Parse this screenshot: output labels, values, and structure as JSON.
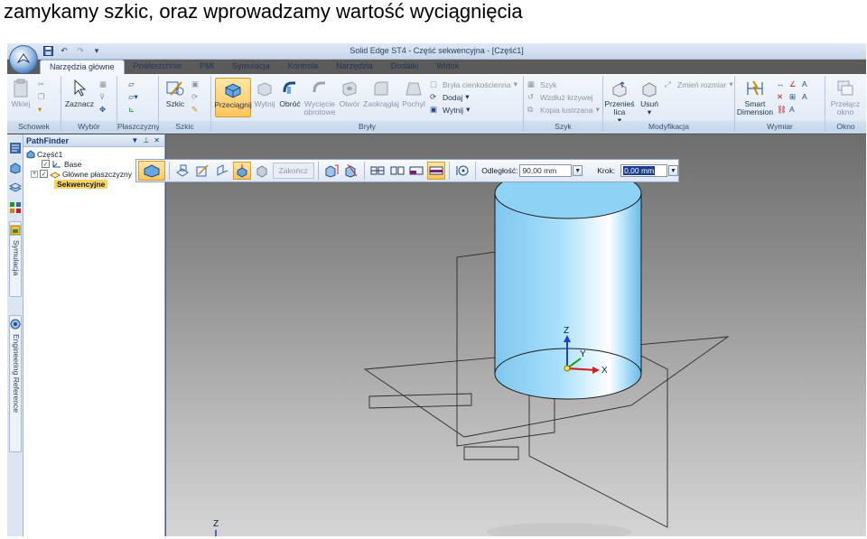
{
  "caption": "zamykamy szkic, oraz wprowadzamy wartość wyciągnięcia",
  "window": {
    "title": "Solid Edge ST4 - Część sekwencyjna - [Część1]"
  },
  "tabs": [
    "Narzędzia główne",
    "Powierzchnie",
    "PMI",
    "Symulacja",
    "Kontrola",
    "Narzędzia",
    "Dodatki",
    "Widok"
  ],
  "ribbon": {
    "groups": {
      "schowek": "Schowek",
      "wybor": "Wybór",
      "plaszczyzny": "Płaszczyzny",
      "szkic": "Szkic",
      "bryly": "Bryły",
      "szyk": "Szyk",
      "modyfikacja": "Modyfikacja",
      "wymiar": "Wymiar",
      "okno": "Okno"
    },
    "buttons": {
      "wklej": "Wklej",
      "zaznacz": "Zaznacz",
      "szkic": "Szkic",
      "przeciagnij": "Przeciągnij",
      "wytnij": "Wytnij",
      "obroc": "Obróć",
      "wyciecie_obrotowe": "Wycięcie obrotowe",
      "otwor": "Otwór",
      "zaokraglaj": "Zaokrąglaj",
      "pochyl": "Pochyl",
      "bryla_cienkoscienna": "Bryła cienkościenna",
      "dodaj": "Dodaj",
      "wytnij_small": "Wytnij",
      "szyk": "Szyk",
      "wzdluz_krzywej": "Wzdłuż krzywej",
      "kopia_lustrzana": "Kopia lustrzana",
      "przenies_lica": "Przenieś lica",
      "usun": "Usuń",
      "zmien_rozmiar": "Zmień rozmiar",
      "smart_dimension": "Smart Dimension",
      "przelacz_okno": "Przełącz okno"
    }
  },
  "sidebar": {
    "tabs": {
      "symulacja": "Symulacja",
      "engineering_reference": "Engineering Reference"
    }
  },
  "pathfinder": {
    "title": "PathFinder",
    "root": "Część1",
    "items": [
      "Base",
      "Główne płaszczyzny",
      "Sekwencyjne"
    ]
  },
  "commandbar": {
    "finish_label": "Zakończ",
    "distance_label": "Odległość:",
    "distance_value": "90,00 mm",
    "step_label": "Krok:",
    "step_value": "0,00 mm"
  },
  "viewport": {
    "axis": {
      "z": "Z",
      "y": "Y",
      "x": "X"
    }
  },
  "colors": {
    "accent_active": "#ffc65a",
    "cylinder_fill": "#8ed3f5",
    "cylinder_edge": "#1a1a1a",
    "axis_x": "#d21f1f",
    "axis_y": "#1a9a1a",
    "axis_z": "#1f3fd2"
  }
}
